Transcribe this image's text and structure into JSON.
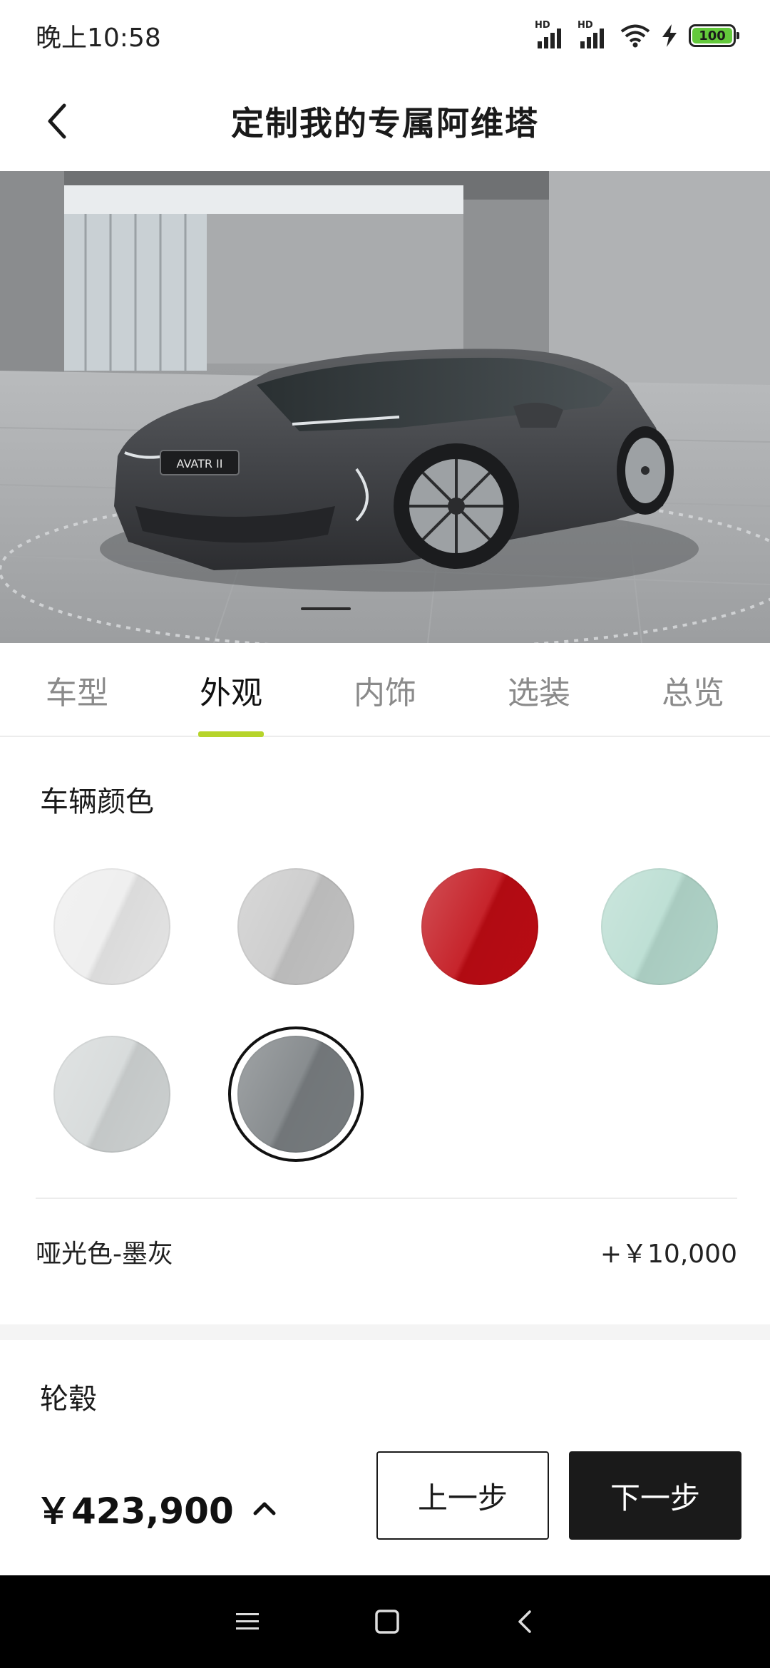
{
  "status_bar": {
    "time": "晚上10:58",
    "network_label": "HD",
    "battery": "100"
  },
  "header": {
    "title": "定制我的专属阿维塔"
  },
  "hero": {
    "car_badge": "AVATR II",
    "alt": "Avatr car exterior preview"
  },
  "tabs": [
    {
      "label": "车型",
      "active": false
    },
    {
      "label": "外观",
      "active": true
    },
    {
      "label": "内饰",
      "active": false
    },
    {
      "label": "选装",
      "active": false
    },
    {
      "label": "总览",
      "active": false
    }
  ],
  "colors": {
    "title": "车辆颜色",
    "swatches": [
      {
        "name": "white",
        "hex": "#ededed",
        "selected": false
      },
      {
        "name": "silver",
        "hex": "#c9c9c9",
        "selected": false
      },
      {
        "name": "red",
        "hex": "#c00c14",
        "selected": false
      },
      {
        "name": "mint",
        "hex": "#b7dcd0",
        "selected": false
      },
      {
        "name": "pale-grey",
        "hex": "#d4d8d8",
        "selected": false
      },
      {
        "name": "ink-grey",
        "hex": "#7b8083",
        "selected": true
      }
    ],
    "selected_label": "哑光色-墨灰",
    "selected_price": "+￥10,000"
  },
  "wheels": {
    "title": "轮毂"
  },
  "bottom": {
    "total_price": "￥423,900",
    "prev_label": "上一步",
    "next_label": "下一步"
  },
  "theme": {
    "accent": "#b6d42a",
    "dark": "#1a1a1a"
  }
}
